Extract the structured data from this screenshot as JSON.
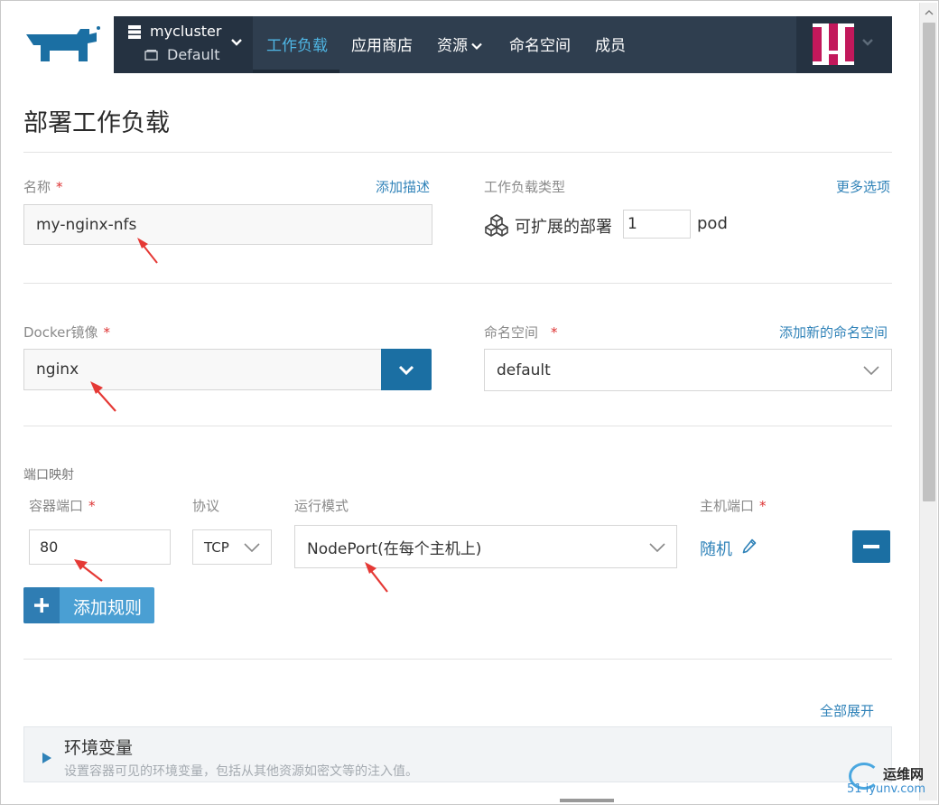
{
  "topnav": {
    "cluster_name": "mycluster",
    "project_name": "Default",
    "items": [
      {
        "label": "工作负载",
        "active": true
      },
      {
        "label": "应用商店"
      },
      {
        "label": "资源"
      },
      {
        "label": "命名空间"
      },
      {
        "label": "成员"
      }
    ]
  },
  "page": {
    "title": "部署工作负载"
  },
  "form": {
    "name_label": "名称",
    "required_mark": "*",
    "add_description": "添加描述",
    "name_value": "my-nginx-nfs",
    "workload_type_label": "工作负载类型",
    "more_options": "更多选项",
    "scalable_deploy": "可扩展的部署",
    "replicas": "1",
    "pod_unit": "pod",
    "docker_image_label": "Docker镜像",
    "docker_image_value": "nginx",
    "namespace_label": "命名空间",
    "add_namespace": "添加新的命名空间",
    "namespace_value": "default",
    "port_mapping_label": "端口映射",
    "container_port_label": "容器端口",
    "protocol_label": "协议",
    "run_mode_label": "运行模式",
    "host_port_label": "主机端口",
    "container_port_value": "80",
    "protocol_value": "TCP",
    "run_mode_value": "NodePort(在每个主机上)",
    "host_port_value": "随机",
    "add_rule": "添加规则",
    "expand_all": "全部展开"
  },
  "accordion": {
    "title": "环境变量",
    "description": "设置容器可见的环境变量，包括从其他资源如密文等的注入值。"
  },
  "watermark": {
    "top": "运维网",
    "bottom": "51 iyunv.com"
  },
  "colors": {
    "nav_bg": "#2f3e4f",
    "accent_blue": "#1b6fa3",
    "link_blue": "#2f82b8",
    "required_red": "#d33",
    "annotation_red": "#e53935"
  }
}
